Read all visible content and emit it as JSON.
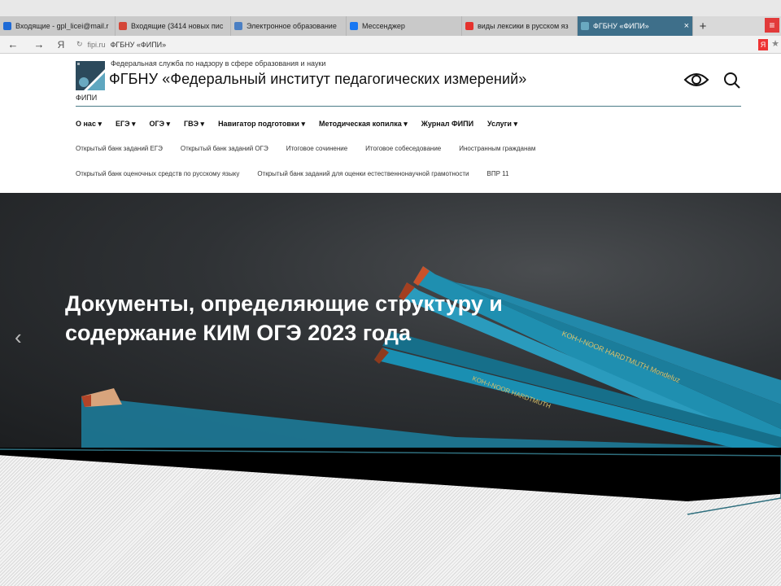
{
  "browser": {
    "tabs": [
      {
        "label": "Входящие - gpl_licei@mail.r",
        "favicon": "mail-icon",
        "color": "#1e6ad6",
        "active": false
      },
      {
        "label": "Входящие (3414 новых пис",
        "favicon": "gmail-icon",
        "color": "#d44638",
        "active": false
      },
      {
        "label": "Электронное образование",
        "favicon": "chart-icon",
        "color": "#4b7fc3",
        "active": false
      },
      {
        "label": "Мессенджер",
        "favicon": "messenger-icon",
        "color": "#1877f2",
        "active": false
      },
      {
        "label": "виды лексики в русском яз",
        "favicon": "yandex-icon",
        "color": "#e5322d",
        "active": false
      },
      {
        "label": "ФГБНУ «ФИПИ»",
        "favicon": "fipi-icon",
        "color": "#6aa9c0",
        "active": true
      }
    ],
    "new_tab": "+",
    "menu": "≡",
    "nav": {
      "back": "←",
      "forward": "→",
      "yandex": "Я"
    },
    "address": {
      "domain": "fipi.ru",
      "page_title": "ФГБНУ «ФИПИ»"
    },
    "bookmark_star": "★",
    "yandex_btn": "Я"
  },
  "site": {
    "logo_abbr": "ФИПИ",
    "subtitle": "Федеральная служба по надзору в сфере образования и науки",
    "title": "ФГБНУ «Федеральный институт педагогических измерений»",
    "main_nav": [
      "О нас ▾",
      "ЕГЭ ▾",
      "ОГЭ ▾",
      "ГВЭ ▾",
      "Навигатор подготовки ▾",
      "Методическая копилка ▾",
      "Журнал ФИПИ",
      "Услуги ▾"
    ],
    "sub_nav_1": [
      "Открытый банк заданий ЕГЭ",
      "Открытый банк заданий ОГЭ",
      "Итоговое сочинение",
      "Итоговое собеседование",
      "Иностранным гражданам"
    ],
    "sub_nav_2": [
      "Открытый банк оценочных средств по русскому языку",
      "Открытый банк заданий для оценки естественнонаучной грамотности",
      "ВПР 11"
    ]
  },
  "hero": {
    "title": "Документы, определяющие структуру и содержание КИМ ОГЭ 2023 года",
    "prev_arrow": "‹"
  },
  "colors": {
    "accent": "#4a7b87",
    "pencil": "#1f8fb0"
  }
}
